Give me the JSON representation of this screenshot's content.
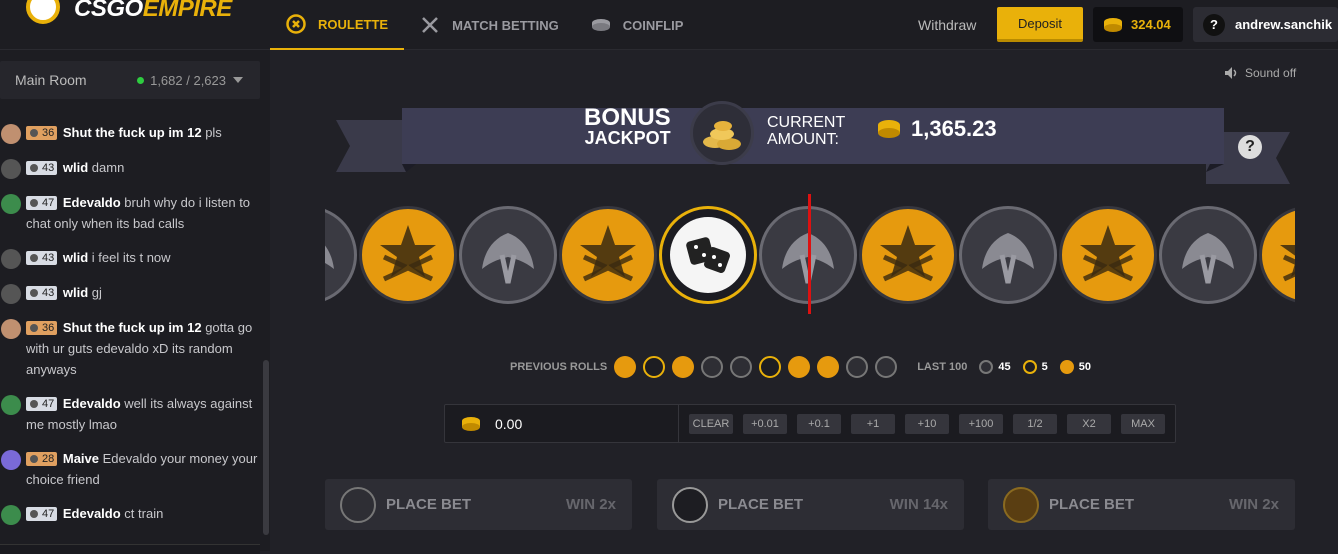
{
  "header": {
    "logo_a": "CSGO",
    "logo_b": "EMPIRE",
    "nav": [
      {
        "label": "ROULETTE",
        "icon": "roulette-icon",
        "active": true
      },
      {
        "label": "MATCH BETTING",
        "icon": "crossed-swords-icon",
        "active": false
      },
      {
        "label": "COINFLIP",
        "icon": "coin-stack-icon",
        "active": false
      }
    ],
    "withdraw": "Withdraw",
    "deposit": "Deposit",
    "balance": "324.04",
    "username": "andrew.sanchik",
    "help": "?"
  },
  "sidebar": {
    "room": "Main Room",
    "online": "1,682 / 2,623",
    "messages": [
      {
        "level": "36",
        "badge": "o",
        "user": "Shut the fuck up im 12",
        "text": "pls",
        "color": "#c09070"
      },
      {
        "level": "43",
        "badge": "w",
        "user": "wlid",
        "text": "damn",
        "color": "#555"
      },
      {
        "level": "47",
        "badge": "w",
        "user": "Edevaldo",
        "text": "bruh why do i listen to chat only when its bad calls",
        "color": "#3c8c4c"
      },
      {
        "level": "43",
        "badge": "w",
        "user": "wlid",
        "text": "i feel its t now",
        "color": "#555"
      },
      {
        "level": "43",
        "badge": "w",
        "user": "wlid",
        "text": "gj",
        "color": "#555"
      },
      {
        "level": "36",
        "badge": "o",
        "user": "Shut the fuck up im 12",
        "text": "gotta go with ur guts edevaldo xD its random anyways",
        "color": "#c09070"
      },
      {
        "level": "47",
        "badge": "w",
        "user": "Edevaldo",
        "text": "well its always against me mostly lmao",
        "color": "#3c8c4c"
      },
      {
        "level": "28",
        "badge": "o",
        "user": "Maive",
        "text": "Edevaldo your money your choice friend",
        "color": "#7a6ad8"
      },
      {
        "level": "47",
        "badge": "w",
        "user": "Edevaldo",
        "text": "ct train",
        "color": "#3c8c4c"
      }
    ]
  },
  "main": {
    "sound": "Sound off",
    "bonus_1": "BONUS",
    "bonus_2": "JACKPOT",
    "current_1": "CURRENT",
    "current_2": "AMOUNT:",
    "jackpot_amount": "1,365.23",
    "reel": [
      "ct",
      "t",
      "ct",
      "t",
      "bonus",
      "ct",
      "t",
      "ct",
      "t",
      "ct",
      "t"
    ],
    "previous_label": "PREVIOUS ROLLS",
    "previous": [
      "t",
      "b",
      "t",
      "ct",
      "ct",
      "b",
      "t",
      "t",
      "ct",
      "ct"
    ],
    "last_label": "LAST 100",
    "last_ct": "45",
    "last_bonus": "5",
    "last_t": "50",
    "bet_value": "0.00",
    "bet_buttons": [
      "CLEAR",
      "+0.01",
      "+0.1",
      "+1",
      "+10",
      "+100",
      "1/2",
      "X2",
      "MAX"
    ],
    "place": [
      {
        "label": "PLACE BET",
        "win": "WIN 2x",
        "type": "ct"
      },
      {
        "label": "PLACE BET",
        "win": "WIN 14x",
        "type": "bonus"
      },
      {
        "label": "PLACE BET",
        "win": "WIN 2x",
        "type": "t"
      }
    ]
  },
  "colors": {
    "accent": "#e9b10a",
    "t": "#e69a0e",
    "ct": "#3a3a42",
    "marker": "#dd1111"
  }
}
